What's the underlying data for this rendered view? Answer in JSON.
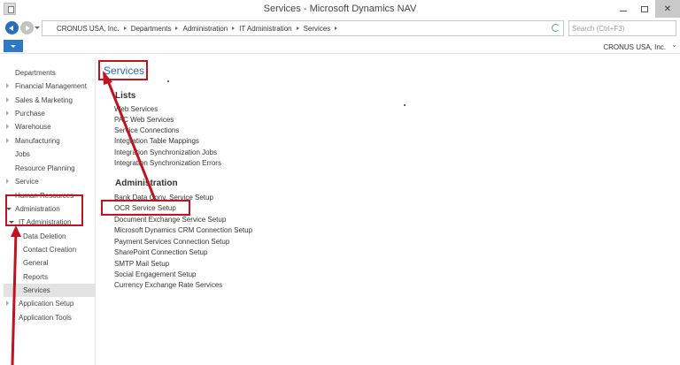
{
  "window": {
    "title": "Services - Microsoft Dynamics NAV"
  },
  "address": {
    "breadcrumbs": [
      "CRONUS USA, Inc.",
      "Departments",
      "Administration",
      "IT Administration",
      "Services"
    ],
    "search_placeholder": "Search (Ctrl+F3)"
  },
  "ribbon": {
    "company": "CRONUS USA, Inc."
  },
  "sidebar": {
    "items": [
      {
        "label": "Departments",
        "expander": "none",
        "active": false
      },
      {
        "label": "Financial Management",
        "expander": "collapsed",
        "active": false
      },
      {
        "label": "Sales & Marketing",
        "expander": "collapsed",
        "active": false
      },
      {
        "label": "Purchase",
        "expander": "collapsed",
        "active": false
      },
      {
        "label": "Warehouse",
        "expander": "collapsed",
        "active": false
      },
      {
        "label": "Manufacturing",
        "expander": "collapsed",
        "active": false
      },
      {
        "label": "Jobs",
        "expander": "none",
        "active": false
      },
      {
        "label": "Resource Planning",
        "expander": "none",
        "active": false
      },
      {
        "label": "Service",
        "expander": "collapsed",
        "active": false
      },
      {
        "label": "Human Resources",
        "expander": "none",
        "active": false
      },
      {
        "label": "Administration",
        "expander": "expanded",
        "active": false
      },
      {
        "label": "IT Administration",
        "expander": "expanded",
        "active": false
      },
      {
        "label": "Data Deletion",
        "expander": "none",
        "active": false
      },
      {
        "label": "Contact Creation",
        "expander": "none",
        "active": false
      },
      {
        "label": "General",
        "expander": "none",
        "active": false
      },
      {
        "label": "Reports",
        "expander": "none",
        "active": false
      },
      {
        "label": "Services",
        "expander": "none",
        "active": true
      },
      {
        "label": "Application Setup",
        "expander": "collapsed",
        "active": false
      },
      {
        "label": "Application Tools",
        "expander": "none",
        "active": false
      }
    ]
  },
  "content": {
    "title": "Services",
    "sections": [
      {
        "heading": "Lists",
        "links": [
          "Web Services",
          "PAC Web Services",
          "Service Connections",
          "Integration Table Mappings",
          "Integration Synchronization Jobs",
          "Integration Synchronization Errors"
        ]
      },
      {
        "heading": "Administration",
        "links": [
          "Bank Data Conv. Service Setup",
          "OCR Service Setup",
          "Document Exchange Service Setup",
          "Microsoft Dynamics CRM Connection Setup",
          "Payment Services Connection Setup",
          "SharePoint Connection Setup",
          "SMTP Mail Setup",
          "Social Engagement Setup",
          "Currency Exchange Rate Services"
        ]
      }
    ]
  },
  "annotation": {
    "color": "#c1121f"
  }
}
